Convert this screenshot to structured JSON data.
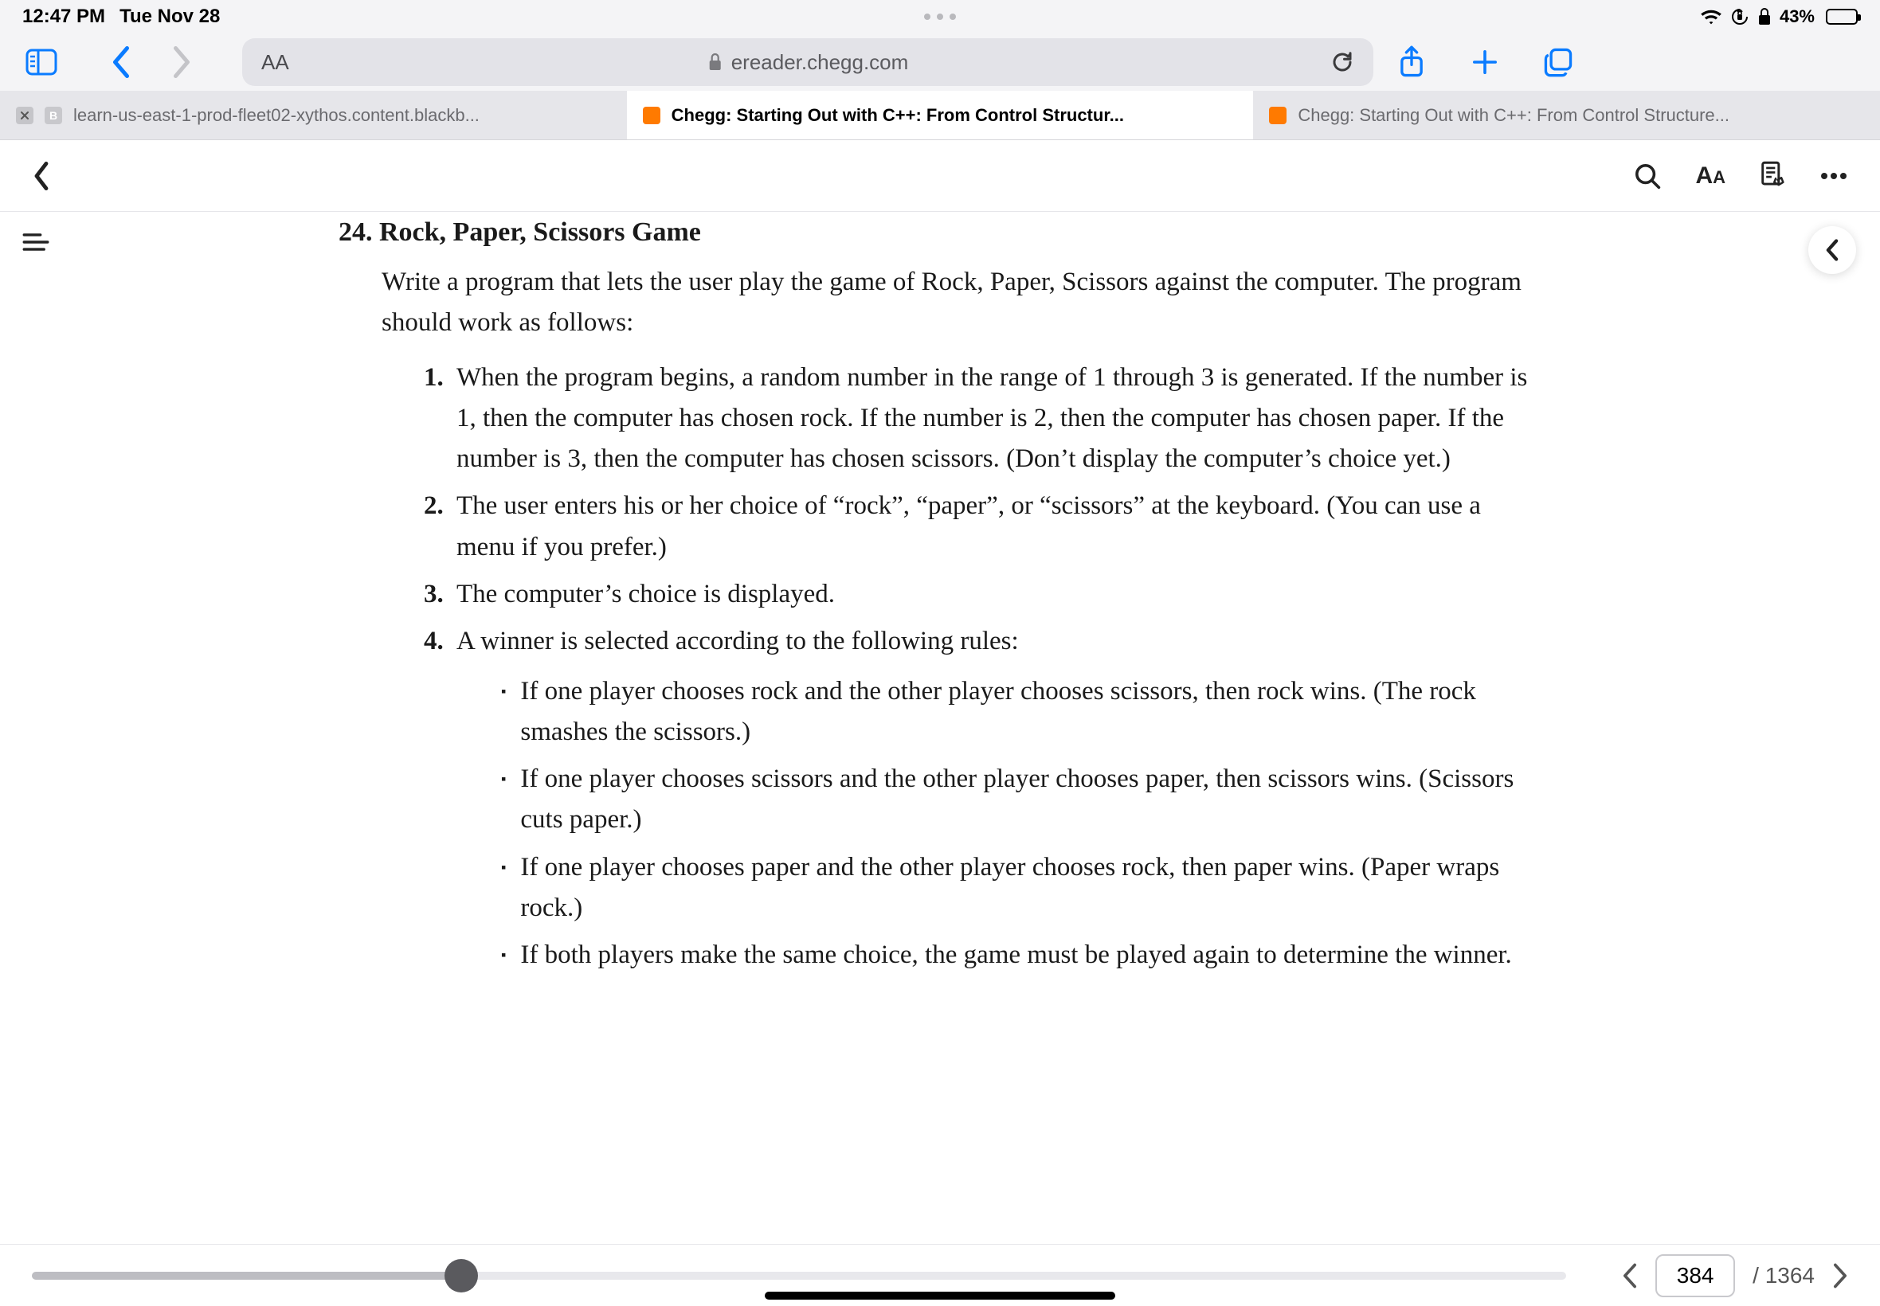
{
  "status": {
    "time": "12:47 PM",
    "date": "Tue Nov 28",
    "battery_pct": "43%",
    "battery_fill_pct": 43
  },
  "safari": {
    "aa": "AA",
    "lock": "🔒",
    "url": "ereader.chegg.com",
    "tabs": [
      {
        "label": "learn-us-east-1-prod-fleet02-xythos.content.blackb...",
        "active": false,
        "favcolor": "#c8c8cc",
        "favtext": "B",
        "closable": true
      },
      {
        "label": "Chegg: Starting Out with C++: From Control Structur...",
        "active": true,
        "favcolor": "#ff7a00",
        "favtext": "",
        "closable": false
      },
      {
        "label": "Chegg: Starting Out with C++: From Control Structure...",
        "active": false,
        "favcolor": "#ff7a00",
        "favtext": "",
        "closable": false
      }
    ]
  },
  "ereader": {
    "heading_number": "24.",
    "heading_text": "Rock, Paper, Scissors Game",
    "intro": "Write a program that lets the user play the game of Rock, Paper, Scissors against the computer. The program should work as follows:",
    "steps": [
      "When the program begins, a random number in the range of 1 through 3 is generated. If the number is 1, then the computer has chosen rock. If the number is 2, then the computer has chosen paper. If the number is 3, then the computer has chosen scissors. (Don’t display the computer’s choice yet.)",
      "The user enters his or her choice of “rock”, “paper”, or “scissors” at the keyboard. (You can use a menu if you prefer.)",
      "The computer’s choice is displayed.",
      "A winner is selected according to the following rules:"
    ],
    "rules": [
      "If one player chooses rock and the other player chooses scissors, then rock wins. (The rock smashes the scissors.)",
      "If one player chooses scissors and the other player chooses paper, then scissors wins. (Scissors cuts paper.)",
      "If one player chooses paper and the other player chooses rock, then paper wins. (Paper wraps rock.)",
      "If both players make the same choice, the game must be played again to determine the winner."
    ],
    "page_current": "384",
    "page_total": "/ 1364",
    "scrub_pct": 28
  }
}
